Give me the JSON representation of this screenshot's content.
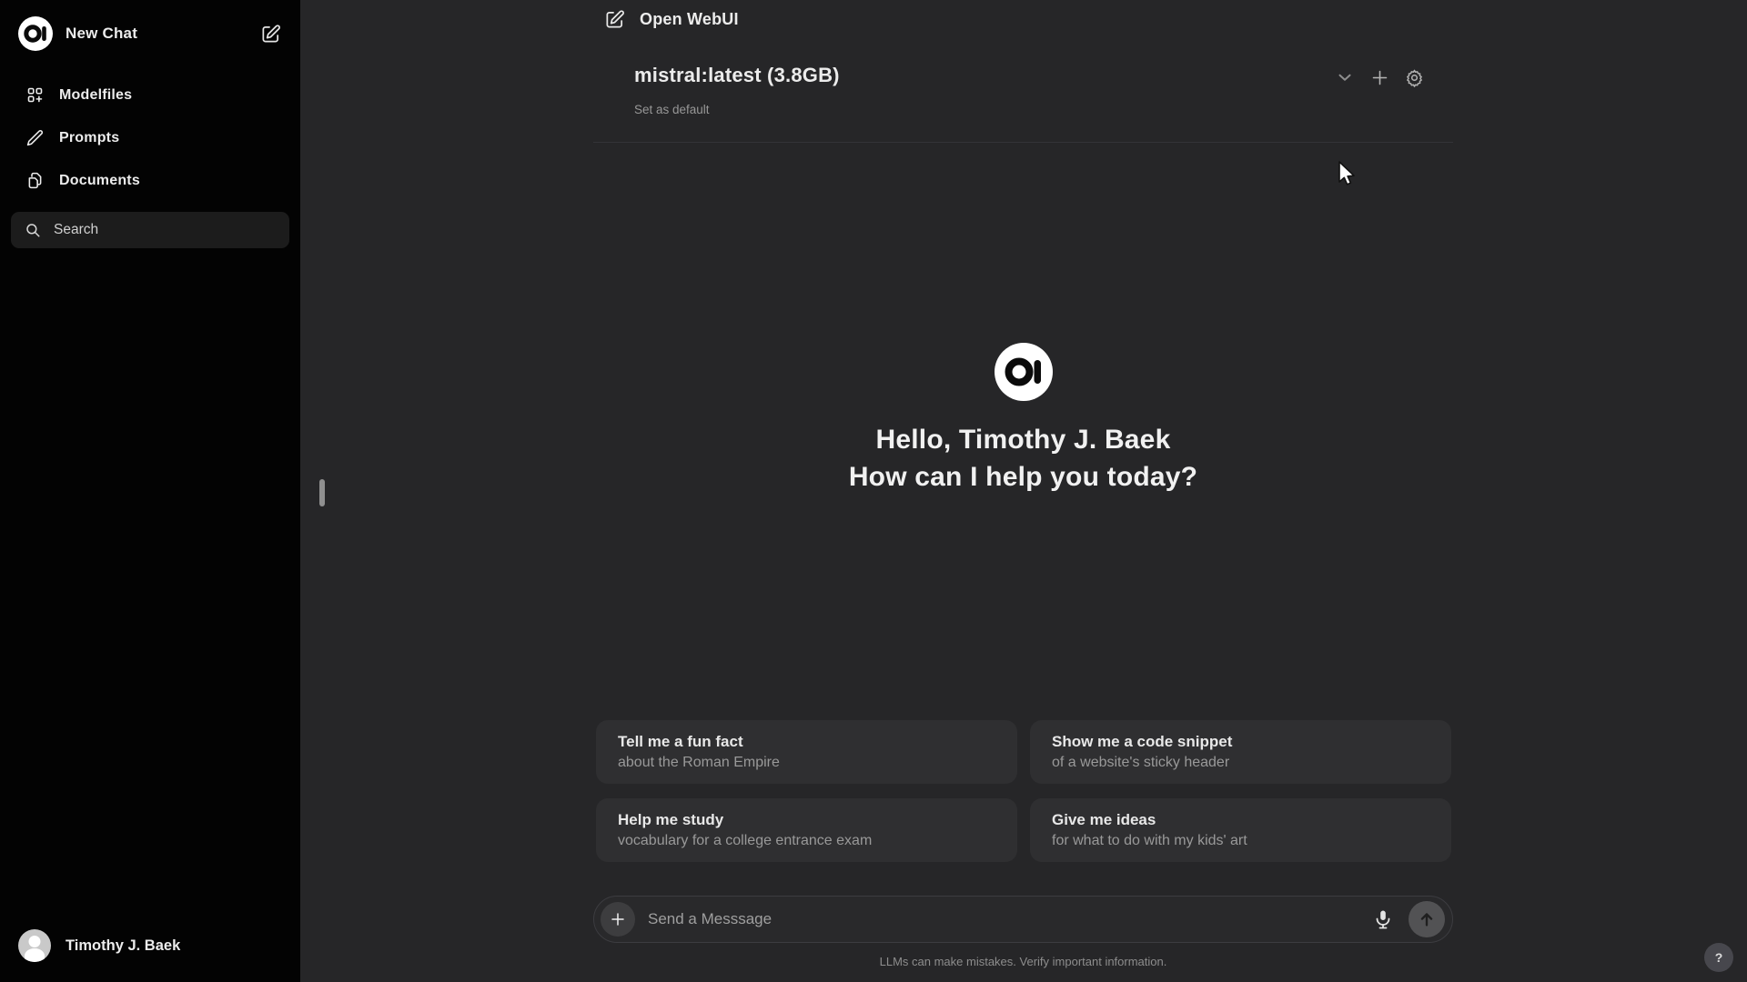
{
  "colors": {
    "sidebar_bg": "#030303",
    "main_bg": "#262628",
    "card_bg": "#2f2f31",
    "search_bg": "#1c1c1c",
    "accent_text": "#ececec",
    "muted_text": "#999999"
  },
  "sidebar": {
    "logo_initials": "OI",
    "new_chat_label": "New Chat",
    "items": [
      {
        "label": "Modelfiles",
        "icon": "modelfiles-icon"
      },
      {
        "label": "Prompts",
        "icon": "pencil-icon"
      },
      {
        "label": "Documents",
        "icon": "documents-icon"
      }
    ],
    "search_label": "Search",
    "user_name": "Timothy J. Baek"
  },
  "header": {
    "title": "Open WebUI"
  },
  "model_selector": {
    "model_name": "mistral:latest (3.8GB)",
    "set_default_label": "Set as default",
    "icons": [
      "chevron-down-icon",
      "plus-icon",
      "gear-icon"
    ]
  },
  "greeting": {
    "line1": "Hello, Timothy J. Baek",
    "line2": "How can I help you today?"
  },
  "suggestions": [
    {
      "title": "Tell me a fun fact",
      "subtitle": "about the Roman Empire"
    },
    {
      "title": "Show me a code snippet",
      "subtitle": "of a website's sticky header"
    },
    {
      "title": "Help me study",
      "subtitle": "vocabulary for a college entrance exam"
    },
    {
      "title": "Give me ideas",
      "subtitle": "for what to do with my kids' art"
    }
  ],
  "composer": {
    "placeholder": "Send a Messsage",
    "input_value": ""
  },
  "footer": {
    "disclaimer": "LLMs can make mistakes. Verify important information.",
    "help_label": "?"
  }
}
